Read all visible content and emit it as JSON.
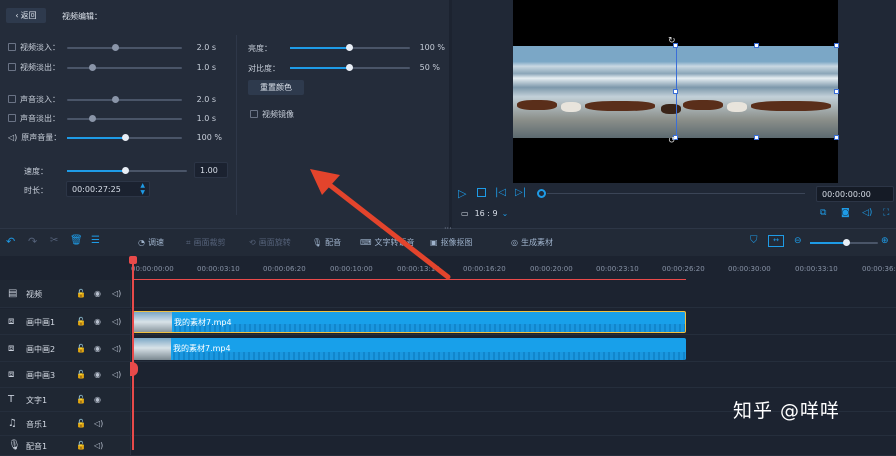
{
  "header": {
    "back_label": "返回",
    "title": "视频编辑："
  },
  "left_controls": {
    "video_fade_in": {
      "label": "视频淡入：",
      "value": "2.0 s",
      "level": 0.4
    },
    "video_fade_out": {
      "label": "视频淡出：",
      "value": "1.0 s",
      "level": 0.2
    },
    "audio_fade_in": {
      "label": "声音淡入：",
      "value": "2.0 s",
      "level": 0.4
    },
    "audio_fade_out": {
      "label": "声音淡出：",
      "value": "1.0 s",
      "level": 0.2
    },
    "original_volume": {
      "label": "原声音量：",
      "value": "100 %",
      "level": 0.5
    },
    "speed": {
      "label": "速度：",
      "value": "1.00",
      "level": 0.5
    },
    "duration": {
      "label": "时长：",
      "value": "00:00:27:25"
    }
  },
  "right_controls": {
    "brightness": {
      "label": "亮度：",
      "value": "100 %",
      "level": 0.5
    },
    "contrast": {
      "label": "对比度：",
      "value": "50 %",
      "level": 0.5
    },
    "reset_color": "重置颜色",
    "mirror": "视频镜像"
  },
  "preview": {
    "time": "00:00:00:00",
    "aspect": "16 : 9"
  },
  "toolbar": {
    "adjust": "调速",
    "crop": "画面裁剪",
    "rotate": "画面旋转",
    "dub": "配音",
    "text_reading": "文字转语音",
    "remove_bg": "抠像抠图",
    "generate": "生成素材"
  },
  "ruler_ticks": [
    "00:00:00:00",
    "00:00:03:10",
    "00:00:06:20",
    "00:00:10:00",
    "00:00:13:10",
    "00:00:16:20",
    "00:00:20:00",
    "00:00:23:10",
    "00:00:26:20",
    "00:00:30:00",
    "00:00:33:10",
    "00:00:36:2"
  ],
  "tracks": [
    {
      "label": "视频",
      "icon": "film-icon"
    },
    {
      "label": "画中画1",
      "icon": "pip-icon",
      "clip": "我的素材7.mp4"
    },
    {
      "label": "画中画2",
      "icon": "pip-icon",
      "clip": "我的素材7.mp4"
    },
    {
      "label": "画中画3",
      "icon": "pip-icon"
    },
    {
      "label": "文字1",
      "icon": "text-icon"
    },
    {
      "label": "音乐1",
      "icon": "music-icon"
    },
    {
      "label": "配音1",
      "icon": "mic-icon"
    }
  ],
  "watermark": "知乎 @咩咩",
  "colors": {
    "accent": "#1e9be6",
    "clip": "#18a0ea",
    "playhead": "#e84a4a",
    "arrow": "#e3442c"
  }
}
